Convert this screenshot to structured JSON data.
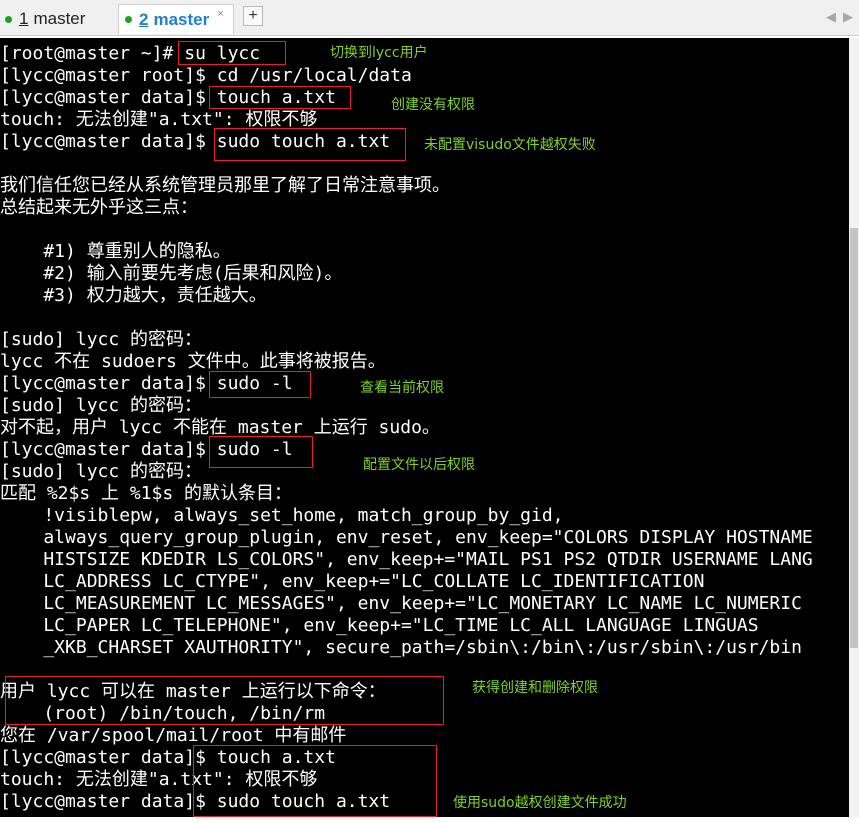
{
  "tabs": [
    {
      "index_label": "1",
      "label": "master",
      "status_color": "#1aa31a"
    },
    {
      "index_label": "2",
      "label": "master",
      "status_color": "#1aa31a",
      "close_label": "×"
    }
  ],
  "toolbar": {
    "new_tab_label": "+",
    "prev_arrow": "◀",
    "next_arrow": "▶"
  },
  "terminal": {
    "lines": [
      "[root@master ~]# su lycc",
      "[lycc@master root]$ cd /usr/local/data",
      "[lycc@master data]$ touch a.txt",
      "touch: 无法创建\"a.txt\": 权限不够",
      "[lycc@master data]$ sudo touch a.txt",
      "",
      "我们信任您已经从系统管理员那里了解了日常注意事项。",
      "总结起来无外乎这三点：",
      "",
      "    #1) 尊重别人的隐私。",
      "    #2) 输入前要先考虑(后果和风险)。",
      "    #3) 权力越大，责任越大。",
      "",
      "[sudo] lycc 的密码：",
      "lycc 不在 sudoers 文件中。此事将被报告。",
      "[lycc@master data]$ sudo -l",
      "[sudo] lycc 的密码：",
      "对不起，用户 lycc 不能在 master 上运行 sudo。",
      "[lycc@master data]$ sudo -l",
      "[sudo] lycc 的密码：",
      "匹配 %2$s 上 %1$s 的默认条目：",
      "    !visiblepw, always_set_home, match_group_by_gid,",
      "    always_query_group_plugin, env_reset, env_keep=\"COLORS DISPLAY HOSTNAME",
      "    HISTSIZE KDEDIR LS_COLORS\", env_keep+=\"MAIL PS1 PS2 QTDIR USERNAME LANG",
      "    LC_ADDRESS LC_CTYPE\", env_keep+=\"LC_COLLATE LC_IDENTIFICATION",
      "    LC_MEASUREMENT LC_MESSAGES\", env_keep+=\"LC_MONETARY LC_NAME LC_NUMERIC",
      "    LC_PAPER LC_TELEPHONE\", env_keep+=\"LC_TIME LC_ALL LANGUAGE LINGUAS",
      "    _XKB_CHARSET XAUTHORITY\", secure_path=/sbin\\:/bin\\:/usr/sbin\\:/usr/bin",
      "",
      "用户 lycc 可以在 master 上运行以下命令：",
      "    (root) /bin/touch, /bin/rm",
      "您在 /var/spool/mail/root 中有邮件",
      "[lycc@master data]$ touch a.txt",
      "touch: 无法创建\"a.txt\": 权限不够",
      "[lycc@master data]$ sudo touch a.txt"
    ],
    "text_color": "#ffffff",
    "background": "#000000"
  },
  "annotations": {
    "color": "#7ed321",
    "box_color": "#e8202a",
    "notes": [
      "切换到lycc用户",
      "创建没有权限",
      "未配置visudo文件越权失败",
      "查看当前权限",
      "配置文件以后权限",
      "获得创建和删除权限",
      "使用sudo越权创建文件成功"
    ]
  }
}
